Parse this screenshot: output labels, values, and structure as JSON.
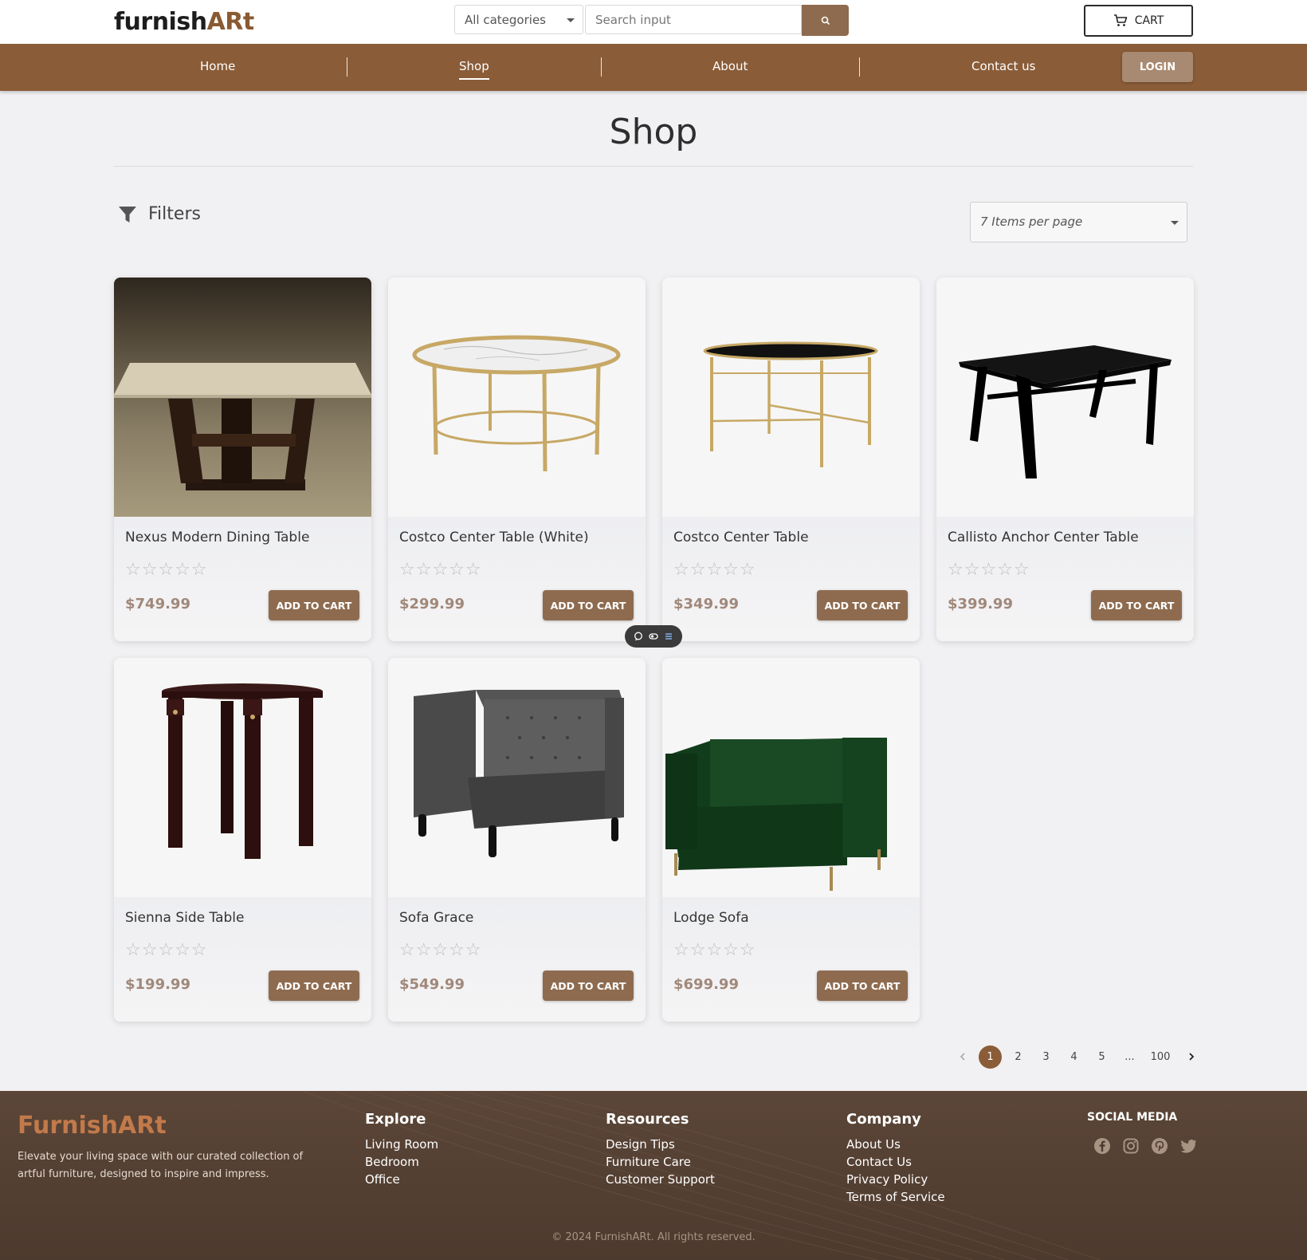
{
  "header": {
    "logo_main": "furnish",
    "logo_accent": "ARt",
    "category_select": "All categories",
    "search_placeholder": "Search input",
    "cart_label": "CART",
    "icons": {
      "search": "search-icon",
      "cart": "cart-icon"
    }
  },
  "nav": {
    "items": [
      "Home",
      "Shop",
      "About",
      "Contact us"
    ],
    "active": "Shop",
    "login_label": "LOGIN"
  },
  "page": {
    "title": "Shop",
    "filters_label": "Filters",
    "per_page": "7 Items per page"
  },
  "products": [
    {
      "name": "Nexus Modern Dining Table",
      "rating": 0,
      "stars": "☆☆☆☆☆",
      "price": "$749.99",
      "button": "ADD TO CART"
    },
    {
      "name": "Costco Center Table (White)",
      "rating": 0,
      "stars": "☆☆☆☆☆",
      "price": "$299.99",
      "button": "ADD TO CART"
    },
    {
      "name": "Costco Center Table",
      "rating": 0,
      "stars": "☆☆☆☆☆",
      "price": "$349.99",
      "button": "ADD TO CART"
    },
    {
      "name": "Callisto Anchor Center Table",
      "rating": 0,
      "stars": "☆☆☆☆☆",
      "price": "$399.99",
      "button": "ADD TO CART"
    },
    {
      "name": "Sienna Side Table",
      "rating": 0,
      "stars": "☆☆☆☆☆",
      "price": "$199.99",
      "button": "ADD TO CART"
    },
    {
      "name": "Sofa Grace",
      "rating": 0,
      "stars": "☆☆☆☆☆",
      "price": "$549.99",
      "button": "ADD TO CART"
    },
    {
      "name": "Lodge Sofa",
      "rating": 0,
      "stars": "☆☆☆☆☆",
      "price": "$699.99",
      "button": "ADD TO CART"
    }
  ],
  "pagination": {
    "pages": [
      "1",
      "2",
      "3",
      "4",
      "5",
      "...",
      "100"
    ],
    "current": "1"
  },
  "footer": {
    "brand": "FurnishARt",
    "description": "Elevate your living space with our curated collection of artful furniture, designed to inspire and impress.",
    "explore": {
      "title": "Explore",
      "links": [
        "Living Room",
        "Bedroom",
        "Office"
      ]
    },
    "resources": {
      "title": "Resources",
      "links": [
        "Design Tips",
        "Furniture Care",
        "Customer Support"
      ]
    },
    "company": {
      "title": "Company",
      "links": [
        "About Us",
        "Contact Us",
        "Privacy Policy",
        "Terms of Service"
      ]
    },
    "social_title": "SOCIAL MEDIA",
    "social_icons": [
      "facebook-icon",
      "instagram-icon",
      "pinterest-icon",
      "twitter-icon"
    ],
    "copyright": "© 2024 FurnishARt. All rights reserved."
  },
  "colors": {
    "brand_brown": "#8a5c38",
    "button_brown": "#8e6b4f",
    "footer_bg": "#4d3a2e",
    "price": "#a0887a"
  }
}
